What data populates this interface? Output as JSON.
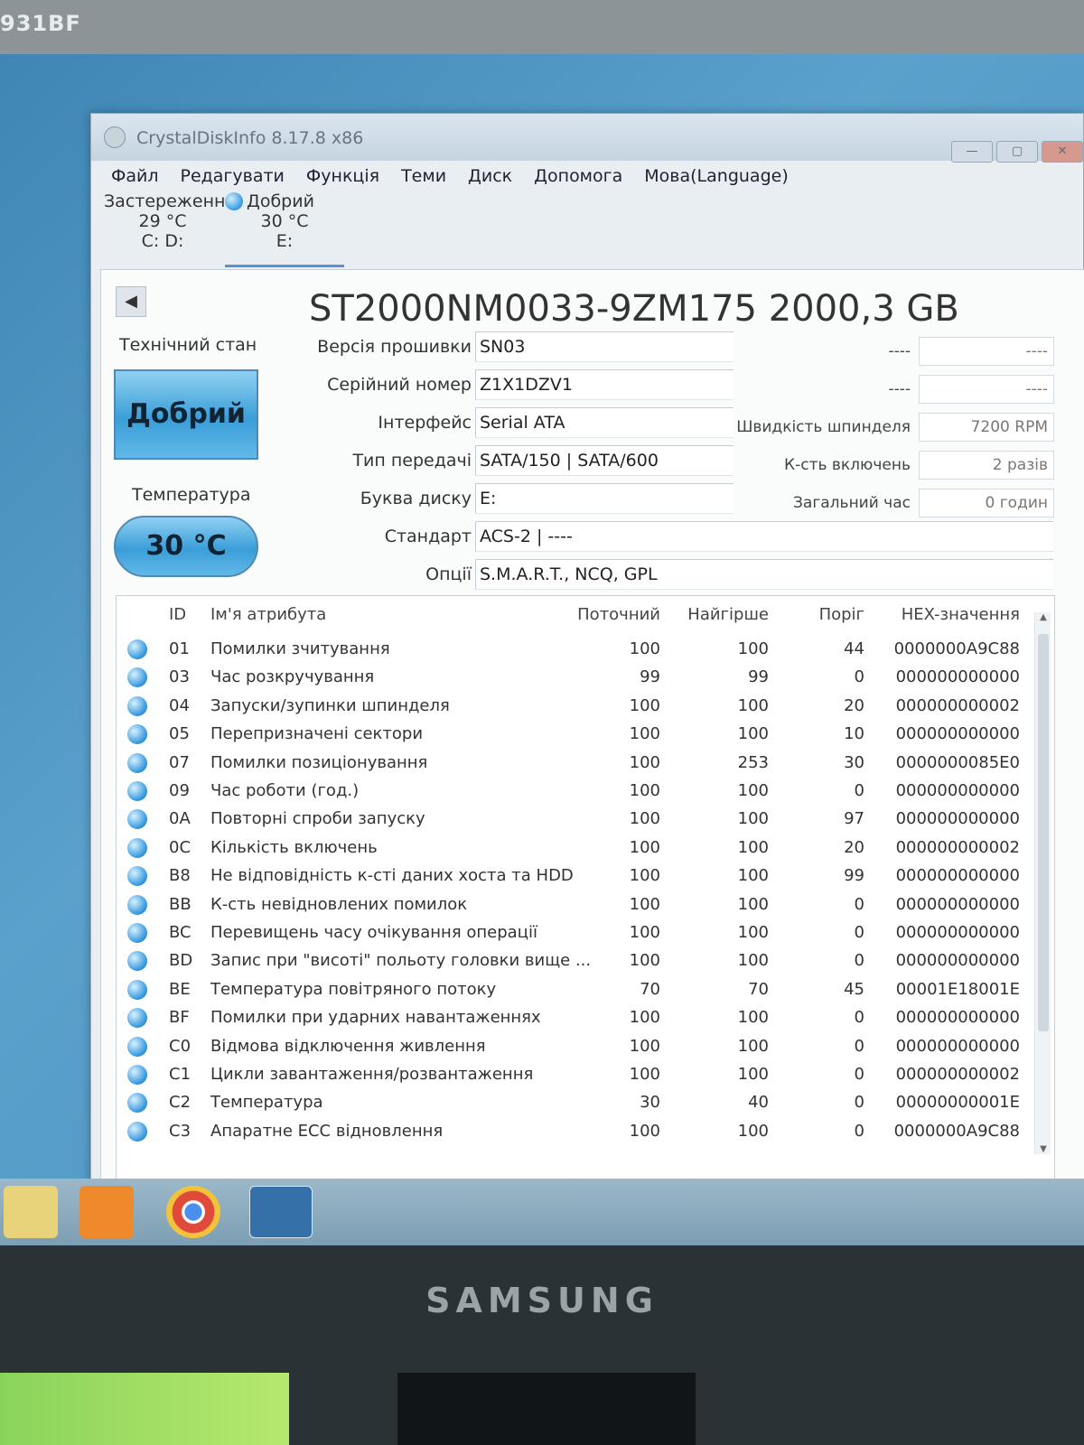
{
  "bezel": {
    "edge_text": "931BF"
  },
  "window": {
    "title": "CrystalDiskInfo 8.17.8 x86",
    "buttons": {
      "minimize": "—",
      "maximize": "▢",
      "close": "✕"
    }
  },
  "menu": [
    "Файл",
    "Редагувати",
    "Функція",
    "Теми",
    "Диск",
    "Допомога",
    "Мова(Language)"
  ],
  "disk_tabs": [
    {
      "status": "Застереження",
      "temp": "29 °C",
      "letters": "C: D:",
      "color": "yellow"
    },
    {
      "status": "Добрий",
      "temp": "30 °C",
      "letters": "E:",
      "color": "blue"
    }
  ],
  "disk": {
    "title": "ST2000NM0033-9ZM175 2000,3 GB",
    "health_label": "Технічний стан",
    "health_value": "Добрий",
    "temp_label": "Температура",
    "temp_value": "30 °C",
    "prev_arrow": "◀"
  },
  "fields": [
    {
      "label": "Версія прошивки",
      "value": "SN03"
    },
    {
      "label": "Серійний номер",
      "value": "Z1X1DZV1"
    },
    {
      "label": "Інтерфейс",
      "value": "Serial ATA"
    },
    {
      "label": "Тип передачі",
      "value": "SATA/150 | SATA/600"
    },
    {
      "label": "Буква диску",
      "value": "E:"
    },
    {
      "label": "Стандарт",
      "value": "ACS-2 | ----"
    },
    {
      "label": "Опції",
      "value": "S.M.A.R.T., NCQ, GPL"
    }
  ],
  "right_fields": [
    {
      "label": "----",
      "value": "----"
    },
    {
      "label": "----",
      "value": "----"
    },
    {
      "label": "Швидкість шпинделя",
      "value": "7200 RPM"
    },
    {
      "label": "К-сть включень",
      "value": "2 разів"
    },
    {
      "label": "Загальний час",
      "value": "0 годин"
    }
  ],
  "smart": {
    "headers": {
      "id": "ID",
      "name": "Ім'я атрибута",
      "current": "Поточний",
      "worst": "Найгірше",
      "threshold": "Поріг",
      "raw": "HEX-значення"
    },
    "rows": [
      {
        "id": "01",
        "name": "Помилки зчитування",
        "current": "100",
        "worst": "100",
        "threshold": "44",
        "raw": "0000000A9C88"
      },
      {
        "id": "03",
        "name": "Час розкручування",
        "current": "99",
        "worst": "99",
        "threshold": "0",
        "raw": "000000000000"
      },
      {
        "id": "04",
        "name": "Запуски/зупинки шпинделя",
        "current": "100",
        "worst": "100",
        "threshold": "20",
        "raw": "000000000002"
      },
      {
        "id": "05",
        "name": "Перепризначені сектори",
        "current": "100",
        "worst": "100",
        "threshold": "10",
        "raw": "000000000000"
      },
      {
        "id": "07",
        "name": "Помилки позиціонування",
        "current": "100",
        "worst": "253",
        "threshold": "30",
        "raw": "0000000085E0"
      },
      {
        "id": "09",
        "name": "Час роботи (год.)",
        "current": "100",
        "worst": "100",
        "threshold": "0",
        "raw": "000000000000"
      },
      {
        "id": "0A",
        "name": "Повторні спроби запуску",
        "current": "100",
        "worst": "100",
        "threshold": "97",
        "raw": "000000000000"
      },
      {
        "id": "0C",
        "name": "Кількість включень",
        "current": "100",
        "worst": "100",
        "threshold": "20",
        "raw": "000000000002"
      },
      {
        "id": "B8",
        "name": "Не відповідність к-сті даних хоста та HDD",
        "current": "100",
        "worst": "100",
        "threshold": "99",
        "raw": "000000000000"
      },
      {
        "id": "BB",
        "name": "К-сть невідновлених помилок",
        "current": "100",
        "worst": "100",
        "threshold": "0",
        "raw": "000000000000"
      },
      {
        "id": "BC",
        "name": "Перевищень часу очікування операції",
        "current": "100",
        "worst": "100",
        "threshold": "0",
        "raw": "000000000000"
      },
      {
        "id": "BD",
        "name": "Запис при \"висоті\" польоту головки вище ...",
        "current": "100",
        "worst": "100",
        "threshold": "0",
        "raw": "000000000000"
      },
      {
        "id": "BE",
        "name": "Температура повітряного потоку",
        "current": "70",
        "worst": "70",
        "threshold": "45",
        "raw": "00001E18001E"
      },
      {
        "id": "BF",
        "name": "Помилки при ударних навантаженнях",
        "current": "100",
        "worst": "100",
        "threshold": "0",
        "raw": "000000000000"
      },
      {
        "id": "C0",
        "name": "Відмова відключення живлення",
        "current": "100",
        "worst": "100",
        "threshold": "0",
        "raw": "000000000000"
      },
      {
        "id": "C1",
        "name": "Цикли завантаження/розвантаження",
        "current": "100",
        "worst": "100",
        "threshold": "0",
        "raw": "000000000002"
      },
      {
        "id": "C2",
        "name": "Температура",
        "current": "30",
        "worst": "40",
        "threshold": "0",
        "raw": "00000000001E"
      },
      {
        "id": "C3",
        "name": "Апаратне ECC відновлення",
        "current": "100",
        "worst": "100",
        "threshold": "0",
        "raw": "0000000A9C88"
      }
    ]
  },
  "taskbar": {
    "icons": [
      "folder-icon",
      "media-player-icon",
      "chrome-icon",
      "crystaldiskinfo-icon"
    ]
  },
  "monitor": {
    "brand": "SAMSUNG"
  },
  "colors": {
    "status_good": "#3a9be0",
    "status_warning": "#e0b820",
    "window_bg": "#e9eef2"
  }
}
